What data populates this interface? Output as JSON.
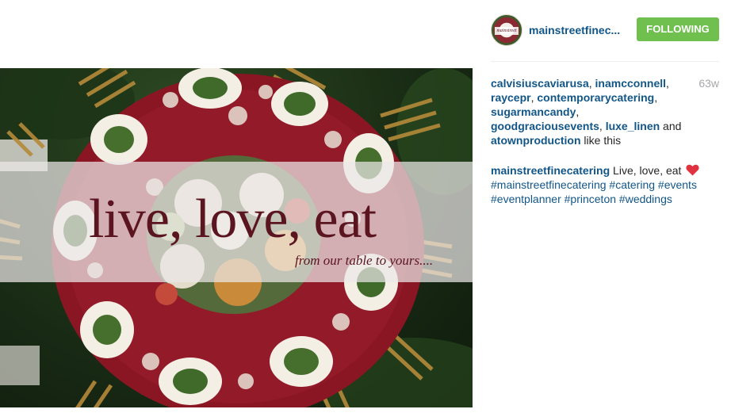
{
  "post": {
    "image": {
      "overlay_title": "live, love, eat",
      "overlay_subtitle": "from our table to yours....",
      "colors": {
        "tablecloth": "#8a1624",
        "grass": "#1f3519",
        "chairs": "#b58a3a",
        "overlay_text": "#5a1521"
      }
    },
    "header": {
      "username": "mainstreetfinec...",
      "follow_button": "FOLLOWING",
      "follow_button_color": "#70c050",
      "avatar_icon": "profile-avatar"
    },
    "likes": {
      "users": [
        "calvisiuscaviarusa",
        "inamcconnell",
        "raycepr",
        "contemporarycatering",
        "sugarmancandy",
        "goodgraciousevents",
        "luxe_linen",
        "atownproduction"
      ],
      "sep": ", ",
      "and_word": " and ",
      "suffix": " like this",
      "age": "63w"
    },
    "caption": {
      "username": "mainstreetfinecatering",
      "text": " Live, love, eat ",
      "emoji_icon": "red-heart-icon",
      "hashtags": [
        "#mainstreetfinecatering",
        "#catering",
        "#events",
        "#eventplanner",
        "#princeton",
        "#weddings"
      ],
      "space": " "
    }
  }
}
